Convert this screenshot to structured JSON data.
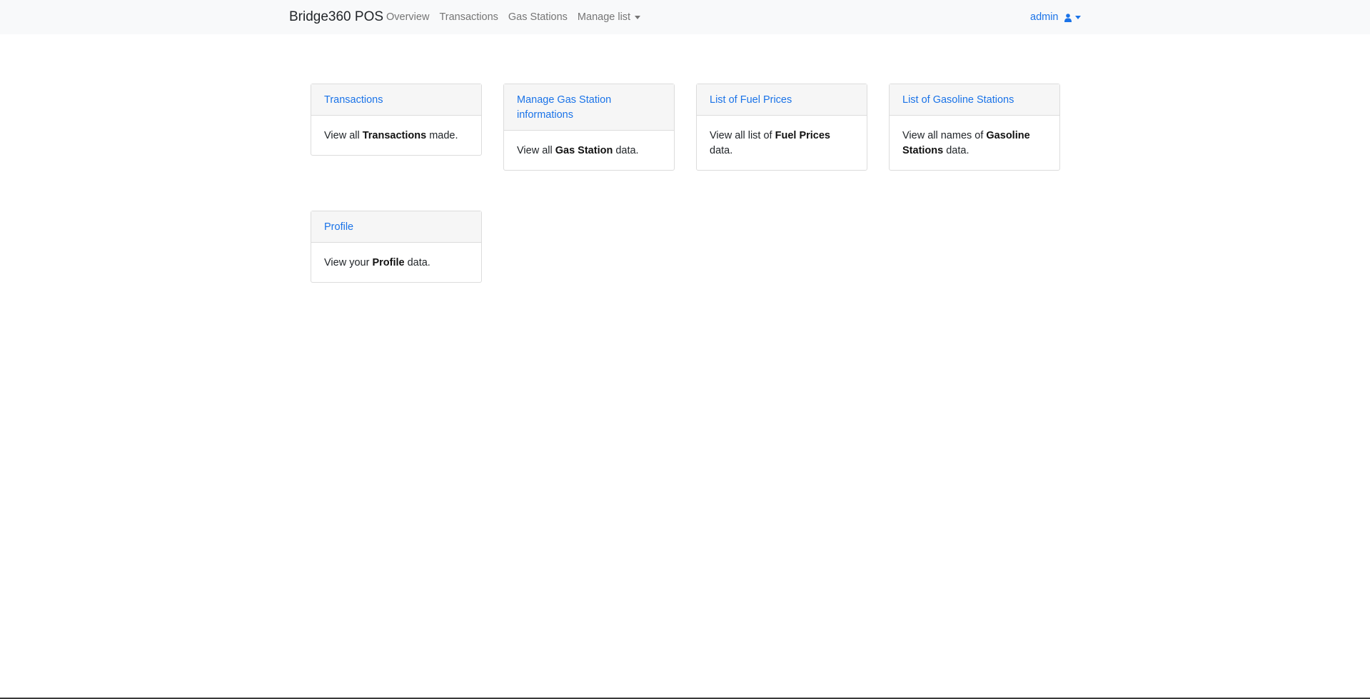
{
  "navbar": {
    "brand": "Bridge360 POS",
    "links": [
      {
        "label": "Overview"
      },
      {
        "label": "Transactions"
      },
      {
        "label": "Gas Stations"
      },
      {
        "label": "Manage list"
      }
    ],
    "user": "admin",
    "user_icon": "user-icon"
  },
  "cards": [
    {
      "title": "Transactions",
      "body_pre": "View all ",
      "body_bold": "Transactions",
      "body_post": " made."
    },
    {
      "title": "Manage Gas Station informations",
      "body_pre": "View all ",
      "body_bold": "Gas Station",
      "body_post": " data."
    },
    {
      "title": "List of Fuel Prices",
      "body_pre": "View all list of ",
      "body_bold": "Fuel Prices",
      "body_post": " data."
    },
    {
      "title": "List of Gasoline Stations",
      "body_pre": "View all names of ",
      "body_bold": "Gasoline Stations",
      "body_post": " data."
    },
    {
      "title": "Profile",
      "body_pre": "View your ",
      "body_bold": "Profile",
      "body_post": " data."
    }
  ],
  "colors": {
    "accent": "#1a73e8",
    "navbar_bg": "#f8f9fa",
    "nav_link": "#757575",
    "card_header_bg": "#f6f6f6",
    "card_border": "#dcdcdc"
  }
}
